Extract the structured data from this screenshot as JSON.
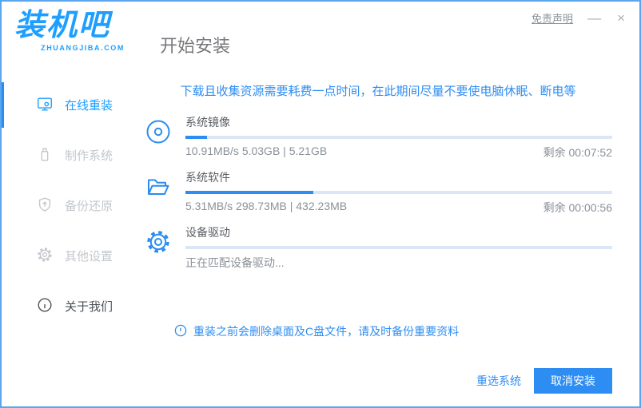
{
  "window": {
    "logo": {
      "name": "装机吧",
      "domain": "ZHUANGJIBA.COM"
    },
    "page_title": "开始安装",
    "titlebar": {
      "disclaimer": "免责声明",
      "minimize": "—",
      "close": "×"
    }
  },
  "sidebar": {
    "items": [
      {
        "label": "在线重装",
        "icon": "monitor-reinstall-icon",
        "active": true
      },
      {
        "label": "制作系统",
        "icon": "usb-drive-icon",
        "active": false
      },
      {
        "label": "备份还原",
        "icon": "backup-shield-icon",
        "active": false
      },
      {
        "label": "其他设置",
        "icon": "settings-gear-icon",
        "active": false
      },
      {
        "label": "关于我们",
        "icon": "info-circle-icon",
        "active": false
      }
    ]
  },
  "main": {
    "notice": "下载且收集资源需要耗费一点时间，在此期间尽量不要使电脑休眠、断电等",
    "tasks": [
      {
        "name": "系统镜像",
        "icon": "disc-icon",
        "progress_percent": 5,
        "detail": "10.91MB/s 5.03GB | 5.21GB",
        "remaining": "剩余 00:07:52"
      },
      {
        "name": "系统软件",
        "icon": "folder-icon",
        "progress_percent": 30,
        "detail": "5.31MB/s 298.73MB | 432.23MB",
        "remaining": "剩余 00:00:56"
      },
      {
        "name": "设备驱动",
        "icon": "gear-icon",
        "progress_percent": 0,
        "detail": "正在匹配设备驱动...",
        "remaining": ""
      }
    ],
    "warning": "重装之前会删除桌面及C盘文件，请及时备份重要资料"
  },
  "footer": {
    "reselect_label": "重选系统",
    "cancel_label": "取消安装"
  },
  "colors": {
    "accent_blue": "#2e8df2",
    "logo_blue": "#1e9fff",
    "window_border": "#5aa7f0",
    "progress_track": "#dbe7f6",
    "inactive_gray": "#c3c7cc",
    "text_gray": "#8b9198"
  }
}
